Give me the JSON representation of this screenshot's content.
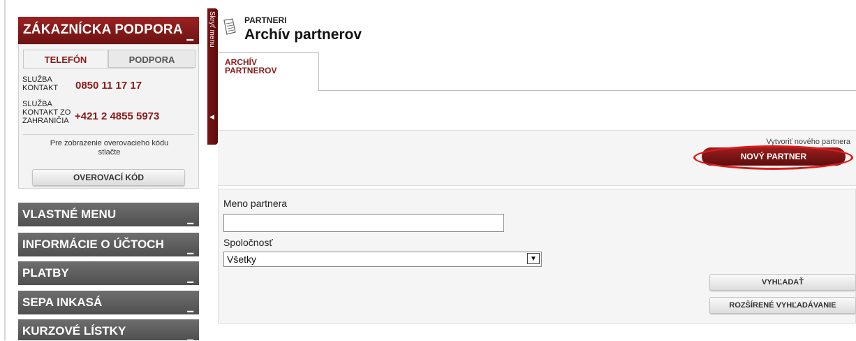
{
  "support": {
    "title": "ZÁKAZNÍCKA PODPORA",
    "tabs": [
      "TELEFÓN",
      "PODPORA"
    ],
    "contacts": [
      {
        "label": "SLUŽBA KONTAKT",
        "number": "0850 11 17 17"
      },
      {
        "label": "SLUŽBA KONTAKT ZO ZAHRANIČIA",
        "number": "+421 2 4855 5973"
      }
    ],
    "note": "Pre zobrazenie overovacieho kódu stlačte",
    "verify_button": "OVEROVACÍ KÓD"
  },
  "menus": [
    {
      "label": "VLASTNÉ MENU"
    },
    {
      "label": "INFORMÁCIE O ÚČTOCH"
    },
    {
      "label": "PLATBY"
    },
    {
      "label": "SEPA INKASÁ"
    },
    {
      "label": "KURZOVÉ LÍSTKY"
    }
  ],
  "hide_menu": "Skryť menu",
  "header": {
    "crumb": "PARTNERI",
    "title": "Archív partnerov"
  },
  "tabs": {
    "active": "ARCHÍV PARTNEROV"
  },
  "action": {
    "text": "Vytvoriť nového partnera",
    "button": "NOVÝ PARTNER"
  },
  "form": {
    "name_label": "Meno partnera",
    "name_value": "",
    "company_label": "Spoločnosť",
    "company_selected": "Všetky",
    "search_button": "VYHĽADAŤ",
    "advanced_button": "ROZŠÍRENÉ VYHĽADÁVANIE"
  },
  "colors": {
    "brand": "#8b1a1a",
    "menu": "#5a5a5a",
    "highlight": "#e01818"
  }
}
